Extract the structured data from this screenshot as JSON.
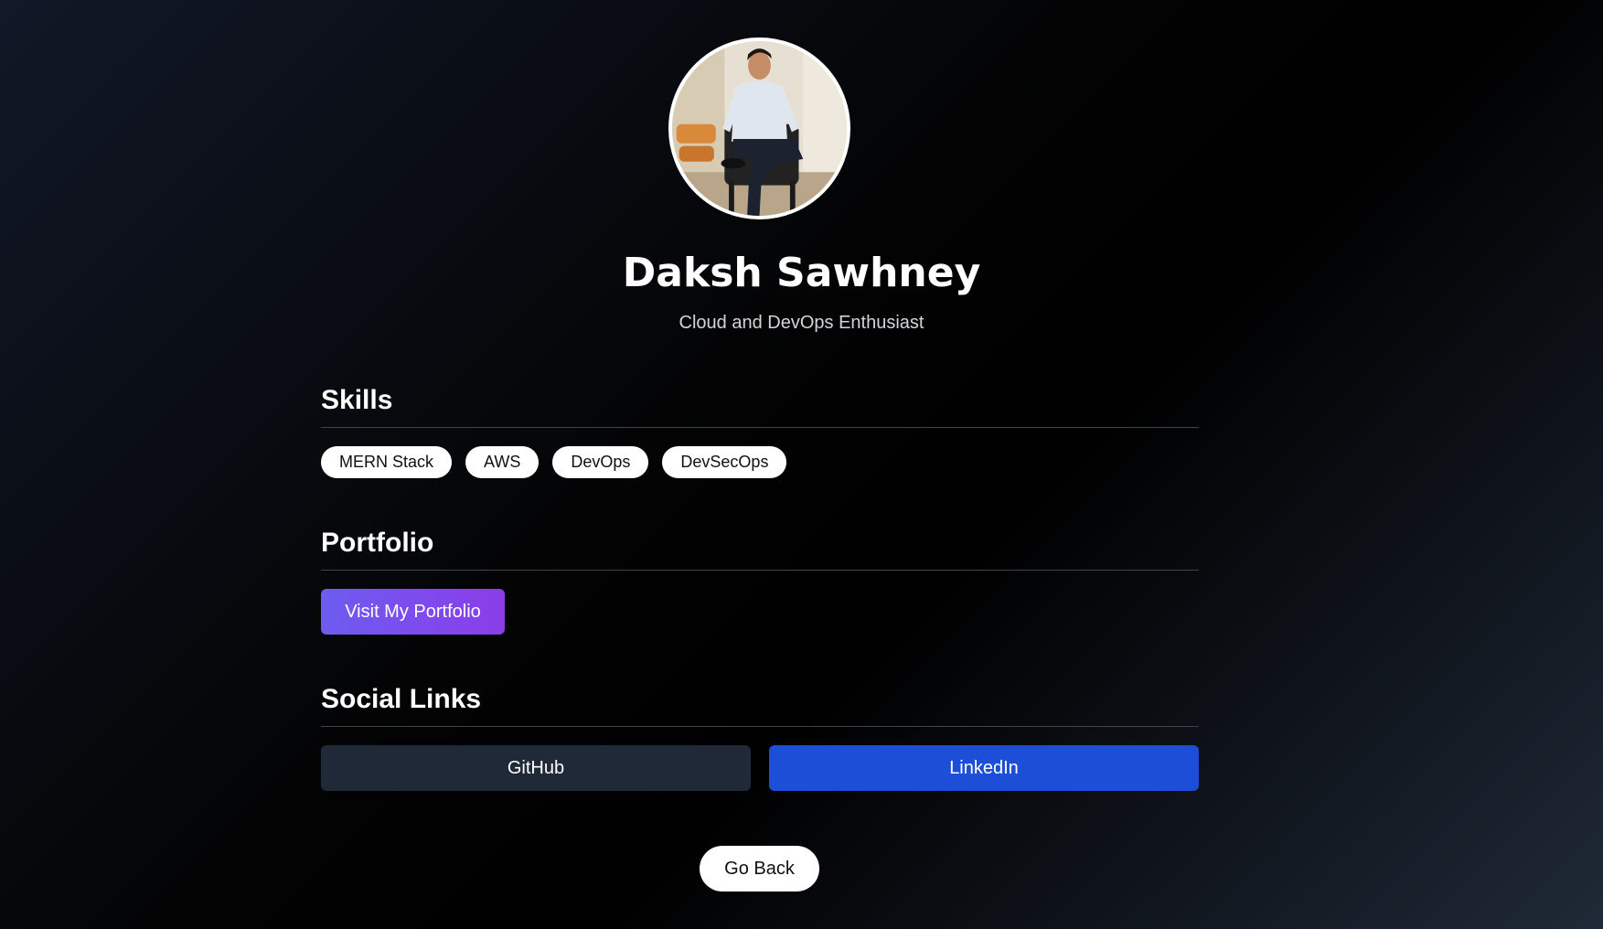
{
  "profile": {
    "name": "Daksh Sawhney",
    "tagline": "Cloud and DevOps Enthusiast"
  },
  "skills": {
    "title": "Skills",
    "items": [
      "MERN Stack",
      "AWS",
      "DevOps",
      "DevSecOps"
    ]
  },
  "portfolio": {
    "title": "Portfolio",
    "button_label": "Visit My Portfolio"
  },
  "social": {
    "title": "Social Links",
    "github_label": "GitHub",
    "linkedin_label": "LinkedIn"
  },
  "back_label": "Go Back",
  "colors": {
    "portfolio_gradient_start": "#6d5cf0",
    "portfolio_gradient_end": "#8b3de8",
    "github_bg": "#1f2937",
    "linkedin_bg": "#1d4ed8"
  }
}
